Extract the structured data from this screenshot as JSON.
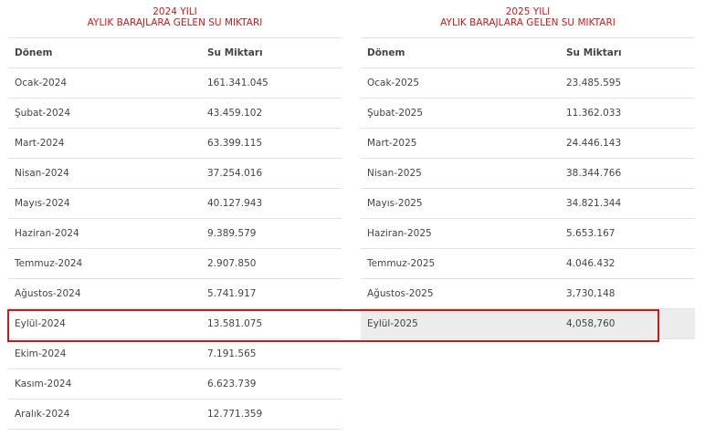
{
  "left": {
    "year_title": "2024 YILI",
    "subtitle": "AYLIK BARAJLARA GELEN SU MIKTARI",
    "headers": [
      "Dönem",
      "Su Miktarı"
    ],
    "rows": [
      [
        "Ocak-2024",
        "161.341.045"
      ],
      [
        "Şubat-2024",
        "43.459.102"
      ],
      [
        "Mart-2024",
        "63.399.115"
      ],
      [
        "Nisan-2024",
        "37.254.016"
      ],
      [
        "Mayıs-2024",
        "40.127.943"
      ],
      [
        "Haziran-2024",
        "9.389.579"
      ],
      [
        "Temmuz-2024",
        "2.907.850"
      ],
      [
        "Ağustos-2024",
        "5.741.917"
      ],
      [
        "Eylül-2024",
        "13.581.075"
      ],
      [
        "Ekim-2024",
        "7.191.565"
      ],
      [
        "Kasım-2024",
        "6.623.739"
      ],
      [
        "Aralık-2024",
        "12.771.359"
      ]
    ]
  },
  "right": {
    "year_title": "2025 YILI",
    "subtitle": "AYLIK BARAJLARA GELEN SU MIKTARI",
    "headers": [
      "Dönem",
      "Su Miktarı"
    ],
    "rows": [
      [
        "Ocak-2025",
        "23.485.595"
      ],
      [
        "Şubat-2025",
        "11.362.033"
      ],
      [
        "Mart-2025",
        "24.446.143"
      ],
      [
        "Nisan-2025",
        "38.344.766"
      ],
      [
        "Mayıs-2025",
        "34.821.344"
      ],
      [
        "Haziran-2025",
        "5.653.167"
      ],
      [
        "Temmuz-2025",
        "4.046.432"
      ],
      [
        "Ağustos-2025",
        "3,730,148"
      ],
      [
        "Eylül-2025",
        "4,058,760"
      ]
    ]
  },
  "highlight_color": "#cc1a1a"
}
